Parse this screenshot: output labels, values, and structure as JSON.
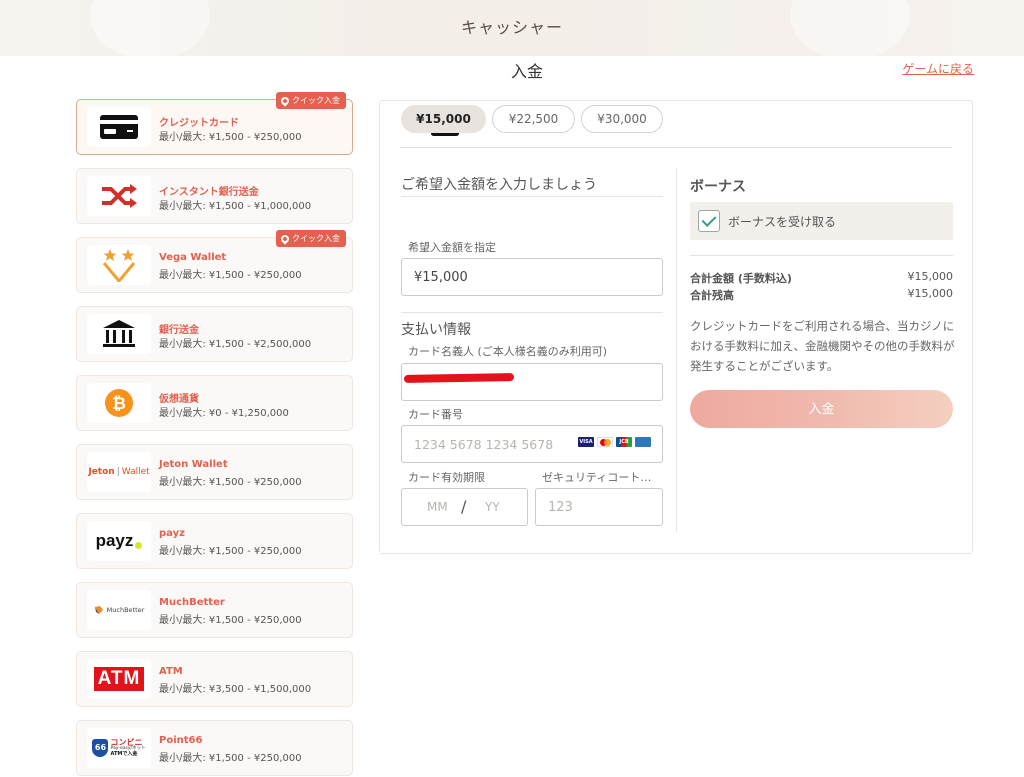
{
  "header": {
    "title": "キャッシャー"
  },
  "page": {
    "title": "入金",
    "back_link": "ゲームに戻る"
  },
  "methods": [
    {
      "name": "クレジットカード",
      "range": "最小/最大: ¥1,500 - ¥250,000",
      "badge": "クイック入金",
      "icon": "credit-card-icon"
    },
    {
      "name": "インスタント銀行送金",
      "range": "最小/最大: ¥1,500 - ¥1,000,000",
      "icon": "shuffle-icon"
    },
    {
      "name": "Vega Wallet",
      "range": "最小/最大: ¥1,500 - ¥250,000",
      "badge": "クイック入金",
      "icon": "vega-wallet-logo"
    },
    {
      "name": "銀行送金",
      "range": "最小/最大: ¥1,500 - ¥2,500,000",
      "icon": "bank-icon"
    },
    {
      "name": "仮想通貨",
      "range": "最小/最大: ¥0 - ¥1,250,000",
      "icon": "bitcoin-icon"
    },
    {
      "name": "Jeton Wallet",
      "range": "最小/最大: ¥1,500 - ¥250,000",
      "icon": "jeton-logo"
    },
    {
      "name": "payz",
      "range": "最小/最大: ¥1,500 - ¥250,000",
      "icon": "payz-logo"
    },
    {
      "name": "MuchBetter",
      "range": "最小/最大: ¥1,500 - ¥250,000",
      "icon": "muchbetter-logo"
    },
    {
      "name": "ATM",
      "range": "最小/最大: ¥3,500 - ¥1,500,000",
      "icon": "atm-logo"
    },
    {
      "name": "Point66",
      "range": "最小/最大: ¥1,500 - ¥250,000",
      "icon": "point66-logo"
    }
  ],
  "logos": {
    "jeton": "Jeton",
    "jeton_wallet": "Wallet",
    "payz": "payz",
    "muchbetter": "MuchBetter",
    "atm": "ATM",
    "point66_num": "66",
    "point66_top": "コンビニ",
    "point66_mid": "Pay-easy/ネット",
    "point66_bot": "ATMで入金"
  },
  "amount": {
    "section_title": "ご希望入金額を入力しましょう",
    "presets": [
      "¥15,000",
      "¥22,500",
      "¥30,000"
    ],
    "active_preset": 0,
    "custom_label": "希望入金額を指定",
    "custom_value": "¥15,000"
  },
  "payment": {
    "section_title": "支払い情報",
    "holder_label": "カード名義人 (ご本人様名義のみ利用可)",
    "holder_value": "",
    "number_label": "カード番号",
    "number_placeholder": "1234 5678 1234 5678",
    "brands": [
      "VISA",
      "MC",
      "JCB",
      "AMEX"
    ],
    "expiry_label": "カード有効期限",
    "expiry_mm": "MM",
    "expiry_sep": "/",
    "expiry_yy": "YY",
    "cvc_label": "ゼキュリティコート…",
    "cvc_placeholder": "123"
  },
  "bonus": {
    "title": "ボーナス",
    "checkbox_label": "ボーナスを受け取る",
    "checked": true
  },
  "summary": {
    "total_label": "合計金額 (手数料込)",
    "total_value": "¥15,000",
    "balance_label": "合計残高",
    "balance_value": "¥15,000"
  },
  "note": "クレジットカードをご利用される場合、当カジノにおける手数料に加え、金融機関やその他の手数料が発生することがございます。",
  "deposit_button": "入金",
  "colors": {
    "accent": "#e5604e",
    "button": "#efa99f",
    "check": "#3a9a8a"
  }
}
